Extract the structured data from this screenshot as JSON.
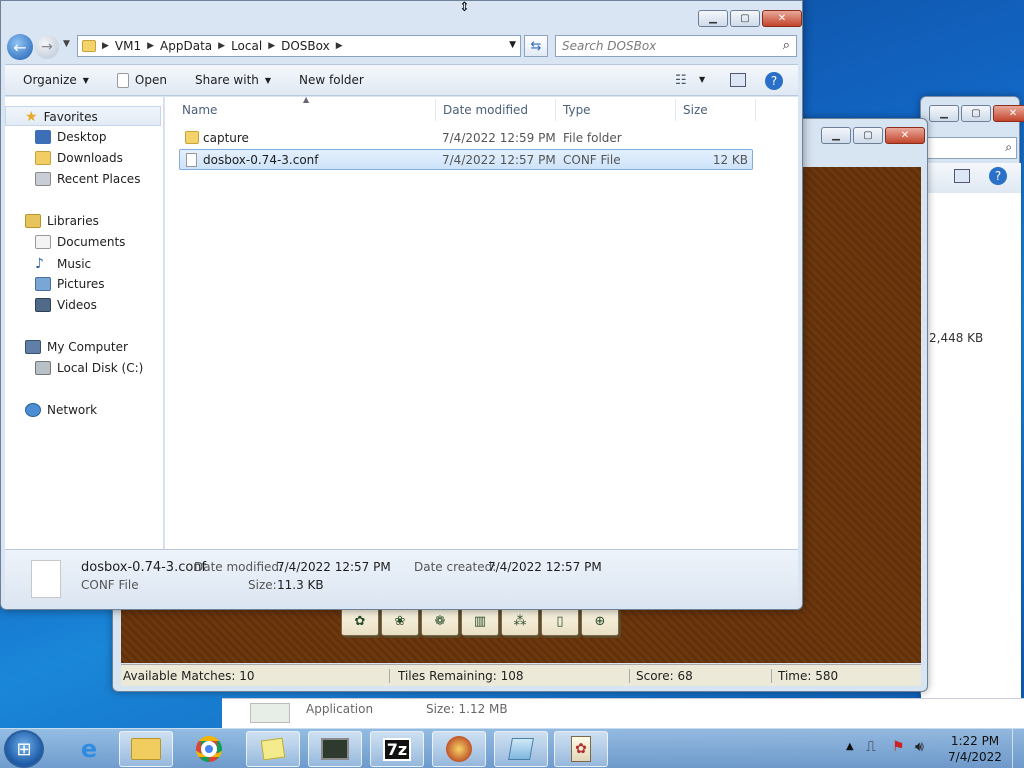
{
  "explorer": {
    "breadcrumb": [
      "VM1",
      "AppData",
      "Local",
      "DOSBox"
    ],
    "search_placeholder": "Search DOSBox",
    "toolbar": {
      "organize": "Organize",
      "open": "Open",
      "share_with": "Share with",
      "new_folder": "New folder"
    },
    "nav": {
      "favorites": "Favorites",
      "desktop": "Desktop",
      "downloads": "Downloads",
      "recent_places": "Recent Places",
      "libraries": "Libraries",
      "documents": "Documents",
      "music": "Music",
      "pictures": "Pictures",
      "videos": "Videos",
      "my_computer": "My Computer",
      "local_disk": "Local Disk (C:)",
      "network": "Network"
    },
    "columns": {
      "name": "Name",
      "date": "Date modified",
      "type": "Type",
      "size": "Size"
    },
    "files": [
      {
        "name": "capture",
        "date": "7/4/2022 12:59 PM",
        "type": "File folder",
        "size": ""
      },
      {
        "name": "dosbox-0.74-3.conf",
        "date": "7/4/2022 12:57 PM",
        "type": "CONF File",
        "size": "12 KB"
      }
    ],
    "details": {
      "filename": "dosbox-0.74-3.conf",
      "filetype": "CONF File",
      "date_modified_label": "Date modified:",
      "date_modified": "7/4/2022 12:57 PM",
      "size_label": "Size:",
      "size": "11.3 KB",
      "date_created_label": "Date created:",
      "date_created": "7/4/2022 12:57 PM"
    }
  },
  "background_window": {
    "size_text": "2,448 KB",
    "row_type": "Application",
    "row_size": "Size: 1.12 MB"
  },
  "mahjong": {
    "available_matches": "Available Matches: 10",
    "tiles_remaining": "Tiles Remaining: 108",
    "score": "Score: 68",
    "time": "Time: 580"
  },
  "taskbar": {
    "time": "1:22 PM",
    "date": "7/4/2022",
    "sevenzip_label": "7z"
  }
}
